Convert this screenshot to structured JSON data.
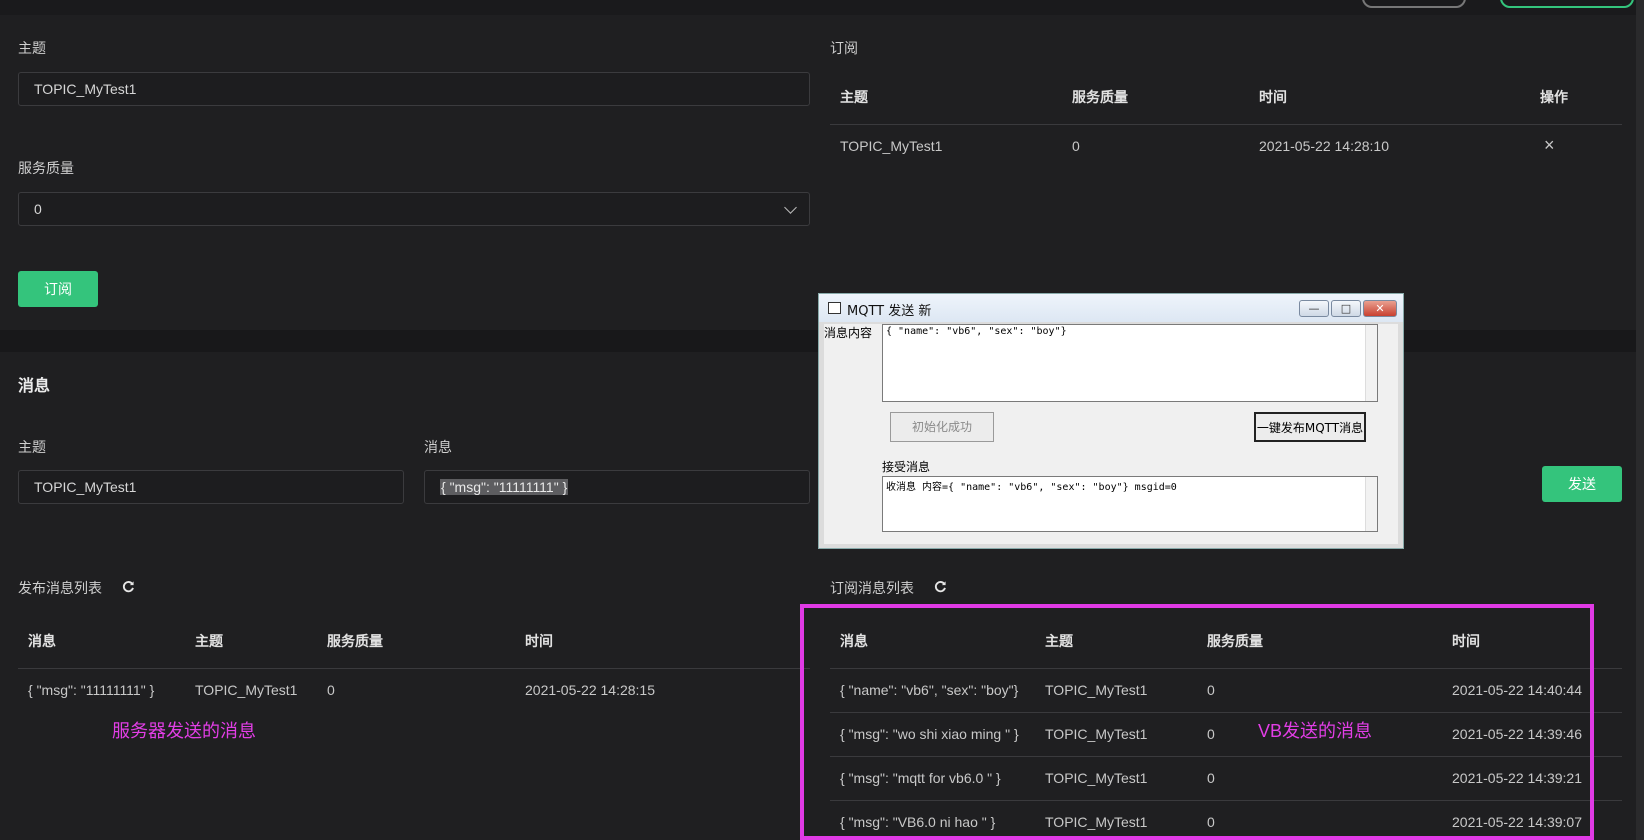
{
  "subscribe_form": {
    "topic_label": "主题",
    "topic_value": "TOPIC_MyTest1",
    "qos_label": "服务质量",
    "qos_value": "0",
    "subscribe_button": "订阅"
  },
  "subscriptions": {
    "title": "订阅",
    "headers": [
      "主题",
      "服务质量",
      "时间",
      "操作"
    ],
    "row": {
      "topic": "TOPIC_MyTest1",
      "qos": "0",
      "time": "2021-05-22 14:28:10",
      "action": "×"
    }
  },
  "message_section": {
    "title": "消息",
    "topic_label": "主题",
    "topic_value": "TOPIC_MyTest1",
    "message_label": "消息",
    "message_value": "{ \"msg\": \"11111111\" }",
    "send_button": "发送"
  },
  "published_list": {
    "title": "发布消息列表",
    "headers": [
      "消息",
      "主题",
      "服务质量",
      "时间"
    ],
    "rows": [
      {
        "msg": "{ \"msg\": \"11111111\" }",
        "topic": "TOPIC_MyTest1",
        "qos": "0",
        "time": "2021-05-22 14:28:15"
      }
    ],
    "annotation": "服务器发送的消息"
  },
  "subscribed_list": {
    "title": "订阅消息列表",
    "headers": [
      "消息",
      "主题",
      "服务质量",
      "时间"
    ],
    "rows": [
      {
        "msg": "{ \"name\": \"vb6\", \"sex\": \"boy\"}",
        "topic": "TOPIC_MyTest1",
        "qos": "0",
        "time": "2021-05-22 14:40:44"
      },
      {
        "msg": "{ \"msg\": \"wo shi xiao ming \" }",
        "topic": "TOPIC_MyTest1",
        "qos": "0",
        "time": "2021-05-22 14:39:46"
      },
      {
        "msg": "{ \"msg\": \"mqtt for vb6.0 \" }",
        "topic": "TOPIC_MyTest1",
        "qos": "0",
        "time": "2021-05-22 14:39:21"
      },
      {
        "msg": "{ \"msg\": \"VB6.0 ni hao \" }",
        "topic": "TOPIC_MyTest1",
        "qos": "0",
        "time": "2021-05-22 14:39:07"
      }
    ],
    "annotation": "VB发送的消息"
  },
  "vb_dialog": {
    "title": "MQTT 发送 新",
    "content_label": "消息内容",
    "content_value": "{ \"name\": \"vb6\", \"sex\": \"boy\"}",
    "init_button": "初始化成功",
    "publish_button": "一键发布MQTT消息",
    "receive_label": "接受消息",
    "receive_value": "收消息   内容={ \"name\": \"vb6\", \"sex\": \"boy\"} msgid=0"
  },
  "colors": {
    "accent": "#34c47c",
    "annotation": "#e23ee6",
    "background": "#1f1f21"
  }
}
